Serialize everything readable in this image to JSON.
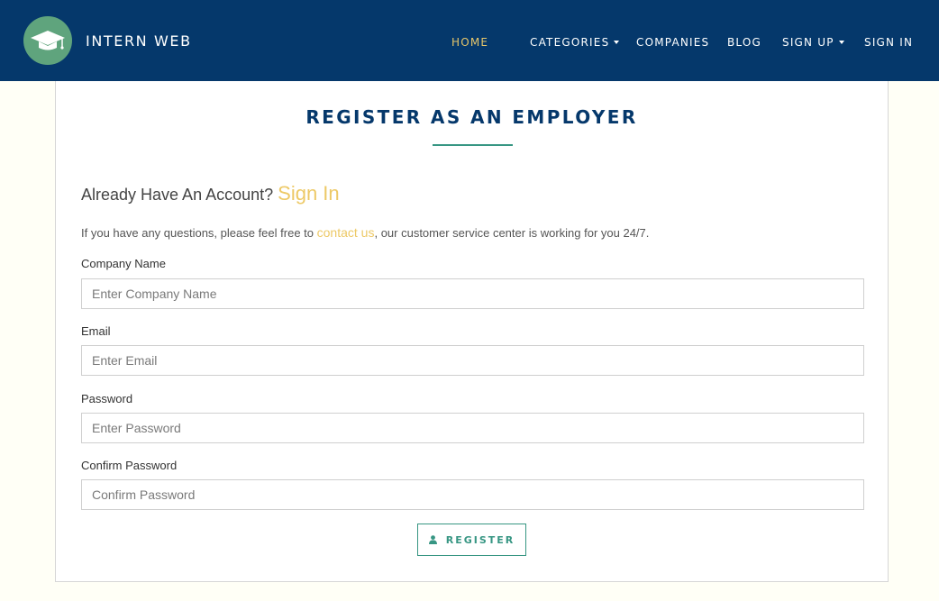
{
  "brand": {
    "name": "INTERN WEB",
    "logo_icon": "graduation-cap-icon"
  },
  "nav": {
    "home": "HOME",
    "categories": "CATEGORIES",
    "companies": "COMPANIES",
    "blog": "BLOG",
    "sign_up": "SIGN UP",
    "sign_in": "SIGN IN"
  },
  "page": {
    "title": "REGISTER AS AN EMPLOYER",
    "already_text": "Already Have An Account?",
    "sign_in_link": "Sign In",
    "note_before": "If you have any questions, please feel free to",
    "contact_link": "contact us",
    "note_after": ", our customer service center is working for you 24/7."
  },
  "form": {
    "company_label": "Company Name",
    "company_placeholder": "Enter Company Name",
    "email_label": "Email",
    "email_placeholder": "Enter Email",
    "password_label": "Password",
    "password_placeholder": "Enter Password",
    "confirm_label": "Confirm Password",
    "confirm_placeholder": "Confirm Password",
    "register_label": "REGISTER",
    "register_icon": "user-icon"
  },
  "colors": {
    "navbar": "#05386b",
    "accent_gold": "#edc966",
    "accent_teal": "#379683",
    "logo_green": "#5fa47d",
    "background": "#fffff6"
  }
}
